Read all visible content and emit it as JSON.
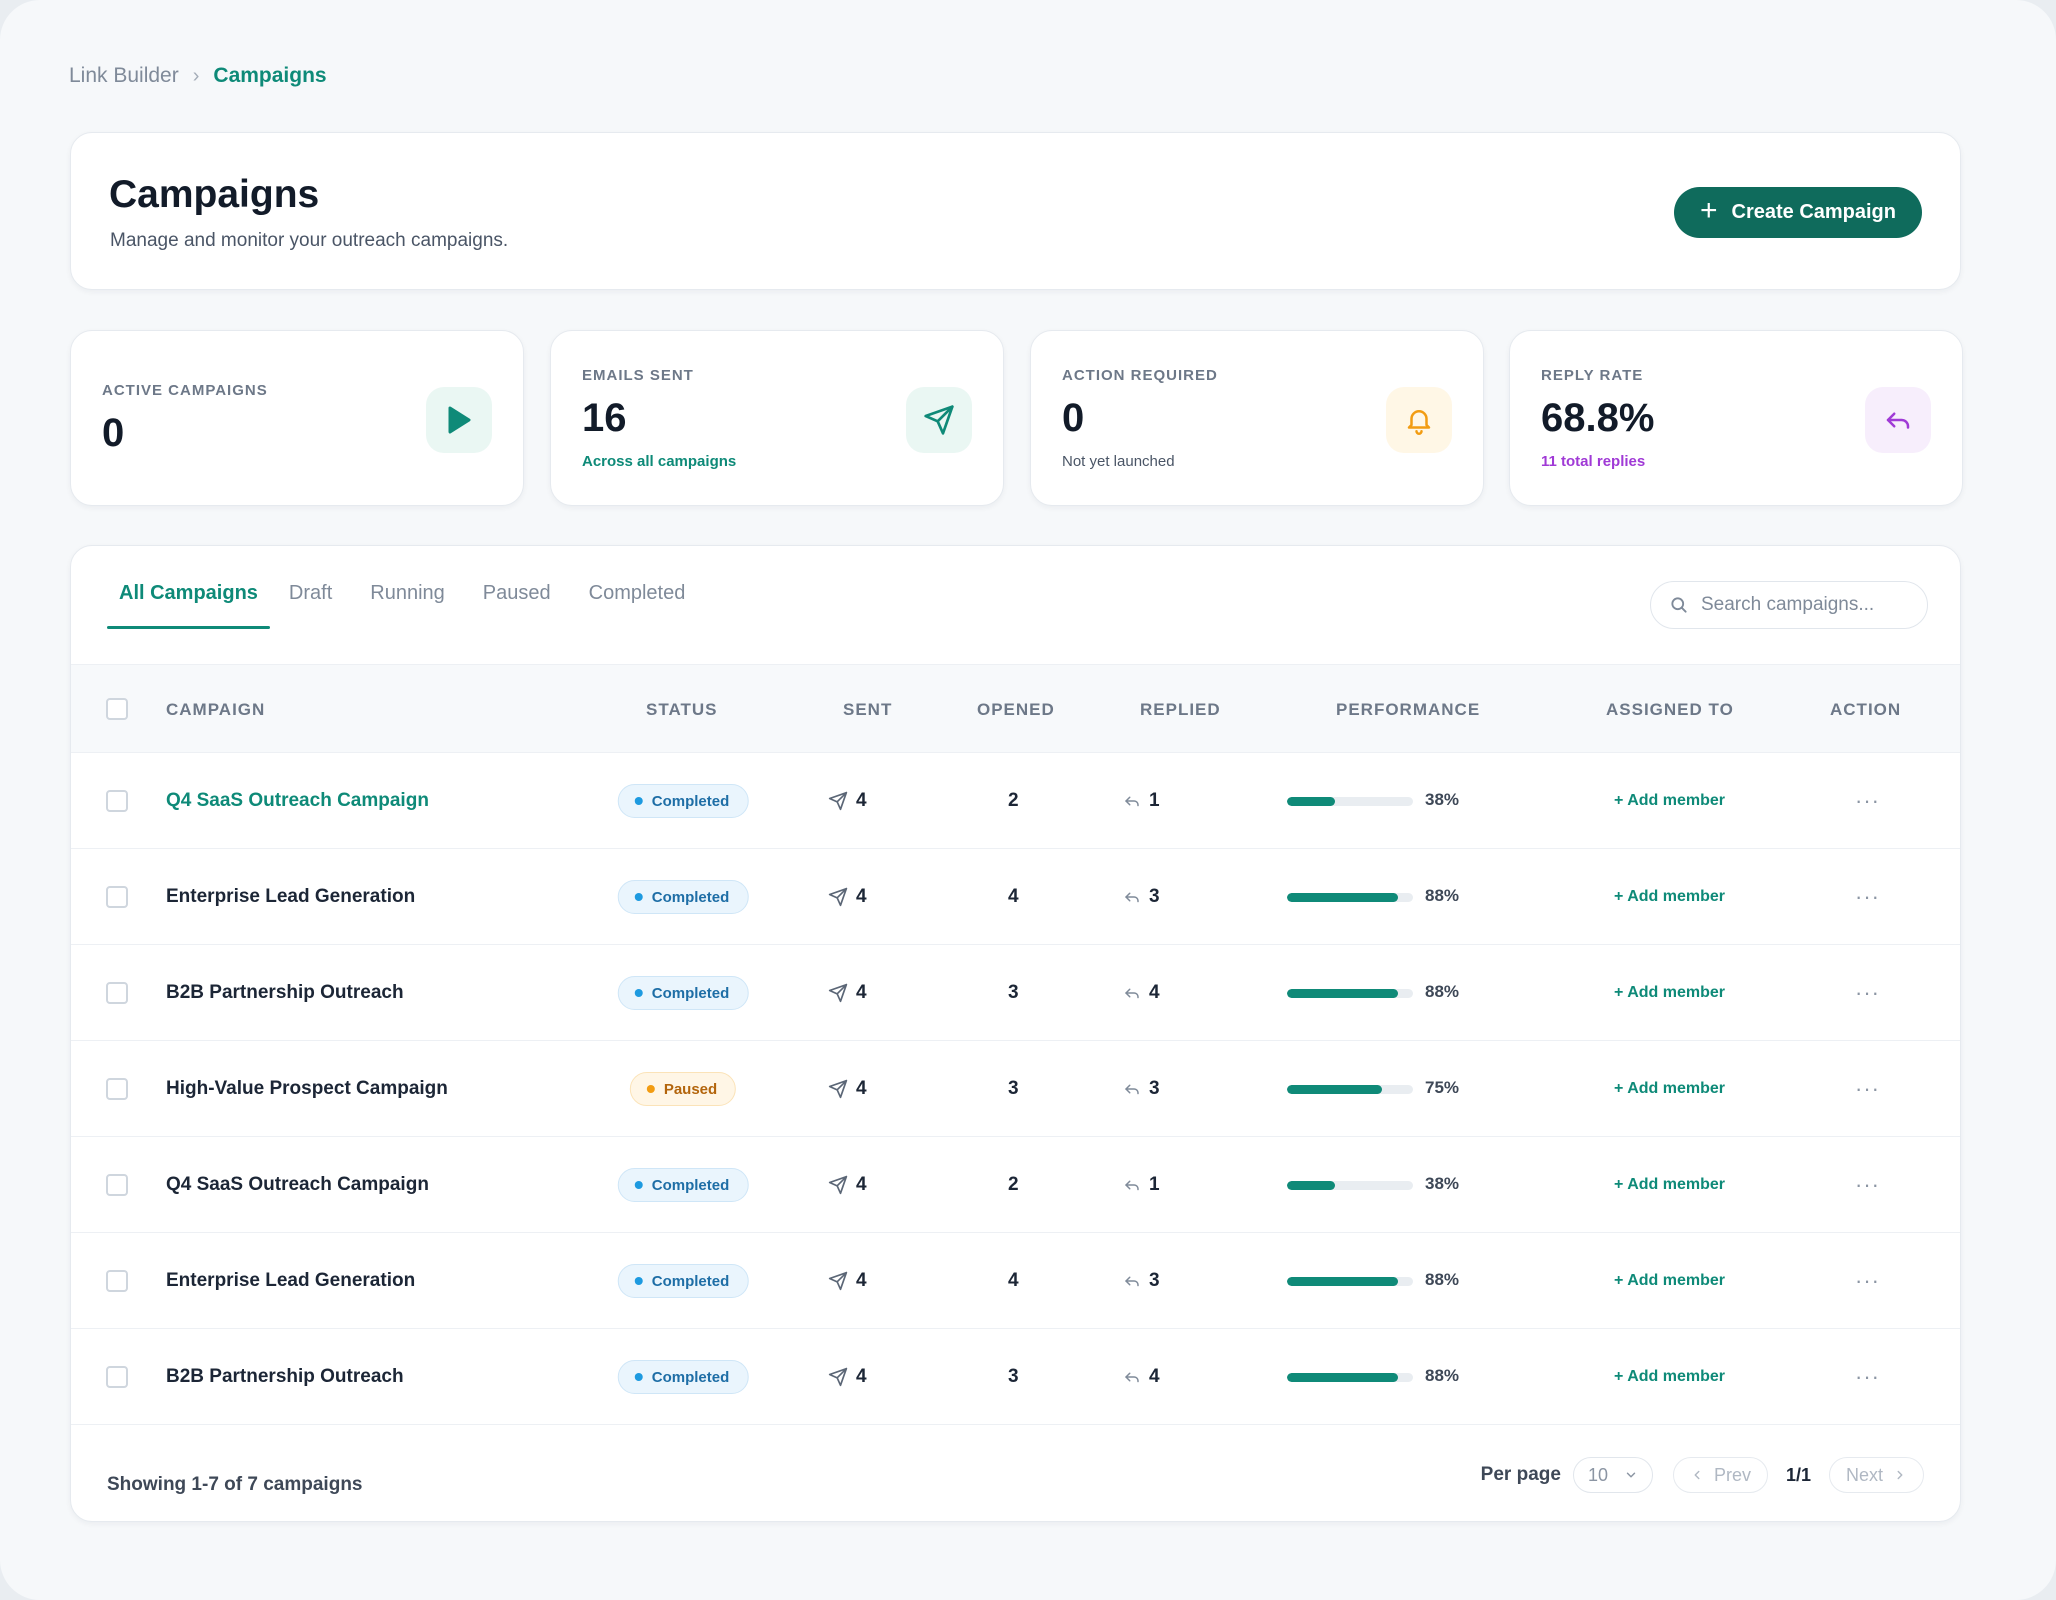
{
  "breadcrumb": {
    "root": "Link Builder",
    "separator": "›",
    "current": "Campaigns"
  },
  "header": {
    "title": "Campaigns",
    "subtitle": "Manage and monitor your outreach campaigns.",
    "create_label": "Create Campaign"
  },
  "stats": [
    {
      "label": "Active Campaigns",
      "value": "0",
      "note": "",
      "icon": "play-icon",
      "color": "#0f8a78",
      "bg": "#eaf7f3"
    },
    {
      "label": "Emails Sent",
      "value": "16",
      "note": "Across all campaigns",
      "icon": "send-icon",
      "color": "#0f8a78",
      "bg": "#eaf7f3"
    },
    {
      "label": "Action Required",
      "value": "0",
      "note": "Not yet launched",
      "icon": "bell-icon",
      "color": "#f29c12",
      "bg": "#fff7e6"
    },
    {
      "label": "Reply Rate",
      "value": "68.8%",
      "note": "11 total replies",
      "icon": "reply-icon",
      "color": "#a03ad6",
      "bg": "#f7eefc"
    }
  ],
  "tabs": [
    "All Campaigns",
    "Draft",
    "Running",
    "Paused",
    "Completed"
  ],
  "search": {
    "placeholder": "Search campaigns..."
  },
  "columns": {
    "campaign": "Campaign",
    "status": "Status",
    "sent": "Sent",
    "opened": "Opened",
    "replied": "Replied",
    "performance": "Performance",
    "assigned": "Assigned To",
    "action": "Action"
  },
  "rows": [
    {
      "name": "Q4 SaaS Outreach Campaign",
      "status": "Completed",
      "sent": "4",
      "opened": "2",
      "replied": "1",
      "performance": 0.38,
      "performance_label": "38%",
      "assign": "+ Add member"
    },
    {
      "name": "Enterprise Lead Generation",
      "status": "Completed",
      "sent": "4",
      "opened": "4",
      "replied": "3",
      "performance": 0.88,
      "performance_label": "88%",
      "assign": "+ Add member"
    },
    {
      "name": "B2B Partnership Outreach",
      "status": "Completed",
      "sent": "4",
      "opened": "3",
      "replied": "4",
      "performance": 0.88,
      "performance_label": "88%",
      "assign": "+ Add member"
    },
    {
      "name": "High-Value Prospect Campaign",
      "status": "Paused",
      "sent": "4",
      "opened": "3",
      "replied": "3",
      "performance": 0.75,
      "performance_label": "75%",
      "assign": "+ Add member"
    },
    {
      "name": "Q4 SaaS Outreach Campaign",
      "status": "Completed",
      "sent": "4",
      "opened": "2",
      "replied": "1",
      "performance": 0.38,
      "performance_label": "38%",
      "assign": "+ Add member"
    },
    {
      "name": "Enterprise Lead Generation",
      "status": "Completed",
      "sent": "4",
      "opened": "4",
      "replied": "3",
      "performance": 0.88,
      "performance_label": "88%",
      "assign": "+ Add member"
    },
    {
      "name": "B2B Partnership Outreach",
      "status": "Completed",
      "sent": "4",
      "opened": "3",
      "replied": "4",
      "performance": 0.88,
      "performance_label": "88%",
      "assign": "+ Add member"
    }
  ],
  "footer": {
    "showing": "Showing 1-7 of 7 campaigns",
    "per_page_label": "Per page",
    "per_page_value": "10",
    "prev_label": "Prev",
    "page_indicator": "1/1",
    "next_label": "Next"
  }
}
